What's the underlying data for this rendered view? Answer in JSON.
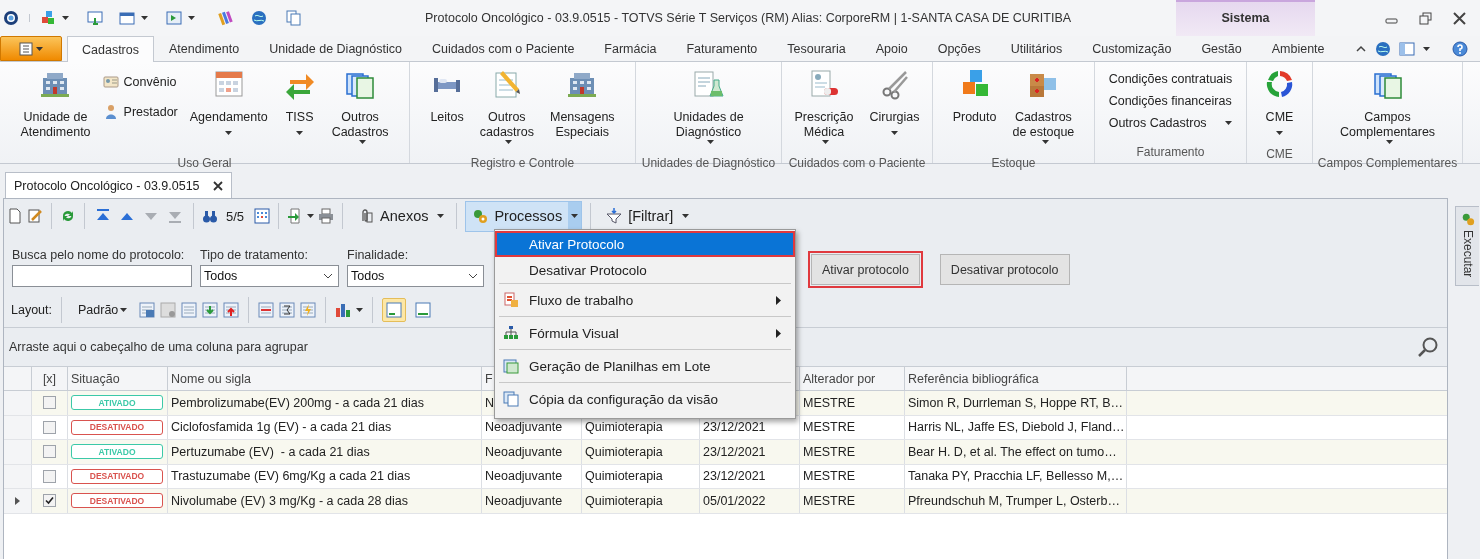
{
  "window": {
    "title": "Protocolo Oncológico - 03.9.0515 - TOTVS Série T Serviços (RM) Alias: CorporeRM | 1-SANTA CASA DE CURITIBA",
    "context_tab": "Sistema"
  },
  "ribbon": {
    "tabs": [
      {
        "label": "Cadastros",
        "selected": true
      },
      {
        "label": "Atendimento",
        "selected": false
      },
      {
        "label": "Unidade de Diagnóstico",
        "selected": false
      },
      {
        "label": "Cuidados com o Paciente",
        "selected": false
      },
      {
        "label": "Farmácia",
        "selected": false
      },
      {
        "label": "Faturamento",
        "selected": false
      },
      {
        "label": "Tesouraria",
        "selected": false
      },
      {
        "label": "Apoio",
        "selected": false
      },
      {
        "label": "Opções",
        "selected": false
      },
      {
        "label": "Utilitários",
        "selected": false
      },
      {
        "label": "Customização",
        "selected": false
      },
      {
        "label": "Gestão",
        "selected": false
      },
      {
        "label": "Ambiente",
        "selected": false
      }
    ],
    "groups": [
      {
        "label": "Uso Geral",
        "items": [
          {
            "kind": "large",
            "label": "Unidade de\nAtendimento",
            "dropdown": false
          },
          {
            "kind": "small",
            "label": "Convênio"
          },
          {
            "kind": "small",
            "label": "Prestador"
          },
          {
            "kind": "large",
            "label": "Agendamento",
            "dropdown": true
          },
          {
            "kind": "large",
            "label": "TISS",
            "dropdown": true
          },
          {
            "kind": "large",
            "label": "Outros\nCadastros",
            "dropdown": true
          }
        ]
      },
      {
        "label": "Registro e Controle",
        "items": [
          {
            "kind": "large",
            "label": "Leitos",
            "dropdown": false
          },
          {
            "kind": "large",
            "label": "Outros\ncadastros",
            "dropdown": true
          },
          {
            "kind": "large",
            "label": "Mensagens\nEspeciais",
            "dropdown": false
          }
        ]
      },
      {
        "label": "Unidades de Diagnóstico",
        "items": [
          {
            "kind": "large",
            "label": "Unidades de\nDiagnóstico",
            "dropdown": true
          }
        ]
      },
      {
        "label": "Cuidados com o Paciente",
        "items": [
          {
            "kind": "large",
            "label": "Prescrição\nMédica",
            "dropdown": true
          },
          {
            "kind": "large",
            "label": "Cirurgias",
            "dropdown": true
          }
        ]
      },
      {
        "label": "Estoque",
        "items": [
          {
            "kind": "large",
            "label": "Produto",
            "dropdown": false
          },
          {
            "kind": "large",
            "label": "Cadastros\nde estoque",
            "dropdown": true
          }
        ]
      },
      {
        "label": "Faturamento",
        "items": [
          {
            "kind": "text",
            "label": "Condições contratuais",
            "dropdown": false
          },
          {
            "kind": "text",
            "label": "Condições financeiras",
            "dropdown": false
          },
          {
            "kind": "text",
            "label": "Outros Cadastros",
            "dropdown": true
          }
        ]
      },
      {
        "label": "CME",
        "items": [
          {
            "kind": "large",
            "label": "CME",
            "dropdown": true
          }
        ]
      },
      {
        "label": "Campos Complementares",
        "items": [
          {
            "kind": "large",
            "label": "Campos\nComplementares",
            "dropdown": true
          }
        ]
      }
    ]
  },
  "document_tab": {
    "label": "Protocolo Oncológico - 03.9.0515"
  },
  "toolbar": {
    "nav": [
      {
        "disabled": false
      },
      {
        "disabled": false
      },
      {
        "disabled": true
      },
      {
        "disabled": true
      }
    ],
    "record_count": "5/5",
    "buttons": [
      {
        "label": "Anexos",
        "open": false
      },
      {
        "label": "Processos",
        "open": true
      },
      {
        "label": "[Filtrar]",
        "open": false
      }
    ]
  },
  "filters": {
    "search": {
      "label": "Busca pelo nome do protocolo:"
    },
    "selects": [
      {
        "label": "Tipo de tratamento:",
        "value": "Todos"
      },
      {
        "label": "Finalidade:",
        "value": "Todos"
      }
    ],
    "buttons": [
      {
        "label": "Ativar protocolo",
        "highlighted": true
      },
      {
        "label": "Desativar protocolo",
        "highlighted": false
      }
    ]
  },
  "layout_bar": {
    "label": "Layout:",
    "preset": "Padrão",
    "toggles": [
      {
        "on": true
      },
      {
        "on": false
      }
    ]
  },
  "group_panel": {
    "hint": "Arraste aqui o cabeçalho de uma coluna para agrupar"
  },
  "table": {
    "columns": {
      "checkbox": "[x]",
      "situacao": "Situação",
      "nome": "Nome ou sigla",
      "column_4": "F",
      "alterador": "Alterador por",
      "referencia": "Referência bibliográfica"
    },
    "rows": [
      {
        "selected": false,
        "checked": false,
        "situacao": {
          "label": "ATIVADO",
          "color": "#3cc9a8"
        },
        "nome": "Pembrolizumabe(EV) 200mg - a cada 21 dias",
        "column_4": "N",
        "alterador": "MESTRE",
        "referencia": "Simon R, Durrleman S, Hoppe RT, B…"
      },
      {
        "selected": false,
        "checked": false,
        "situacao": {
          "label": "DESATIVADO",
          "color": "#d9534f"
        },
        "nome": "Ciclofosfamida 1g (EV) - a cada 21 dias",
        "column_4": "Neoadjuvante",
        "column_5": "Quimioterapia",
        "column_6": "23/12/2021",
        "alterador": "MESTRE",
        "referencia": "Harris NL, Jaffe ES, Diebold J, Fland…"
      },
      {
        "selected": false,
        "checked": false,
        "situacao": {
          "label": "ATIVADO",
          "color": "#3cc9a8"
        },
        "nome": "Pertuzumabe (EV)  - a cada 21 dias",
        "column_4": "Neoadjuvante",
        "column_5": "Quimioterapia",
        "column_6": "23/12/2021",
        "alterador": "MESTRE",
        "referencia": "Bear H. D, et al. The effect on tumo…"
      },
      {
        "selected": false,
        "checked": false,
        "situacao": {
          "label": "DESATIVADO",
          "color": "#d9534f"
        },
        "nome": "Trastuzumabe (EV) 6mg/Kg a cada 21 dias",
        "column_4": "Neoadjuvante",
        "column_5": "Quimioterapia",
        "column_6": "23/12/2021",
        "alterador": "MESTRE",
        "referencia": "Tanaka PY, Pracchia LF, Bellesso M,…"
      },
      {
        "selected": true,
        "checked": true,
        "situacao": {
          "label": "DESATIVADO",
          "color": "#d9534f"
        },
        "nome": "Nivolumabe (EV) 3 mg/Kg - a cada 28 dias",
        "column_4": "Neoadjuvante",
        "column_5": "Quimioterapia",
        "column_6": "05/01/2022",
        "alterador": "MESTRE",
        "referencia": "Pfreundschuh M, Trumper L, Osterb…"
      }
    ]
  },
  "menu": {
    "items": [
      {
        "label": "Ativar Protocolo",
        "selected": true,
        "highlighted": true,
        "submenu": false,
        "separator_before": false
      },
      {
        "label": "Desativar Protocolo",
        "selected": false,
        "highlighted": false,
        "submenu": false,
        "separator_before": false
      },
      {
        "label": "Fluxo de trabalho",
        "selected": false,
        "highlighted": false,
        "submenu": true,
        "separator_before": true
      },
      {
        "label": "Fórmula Visual",
        "selected": false,
        "highlighted": false,
        "submenu": true,
        "separator_before": true
      },
      {
        "label": "Geração de Planilhas em Lote",
        "selected": false,
        "highlighted": false,
        "submenu": false,
        "separator_before": true
      },
      {
        "label": "Cópia da configuração da visão",
        "selected": false,
        "highlighted": false,
        "submenu": false,
        "separator_before": true
      }
    ]
  },
  "dock": {
    "label": "Executar"
  }
}
